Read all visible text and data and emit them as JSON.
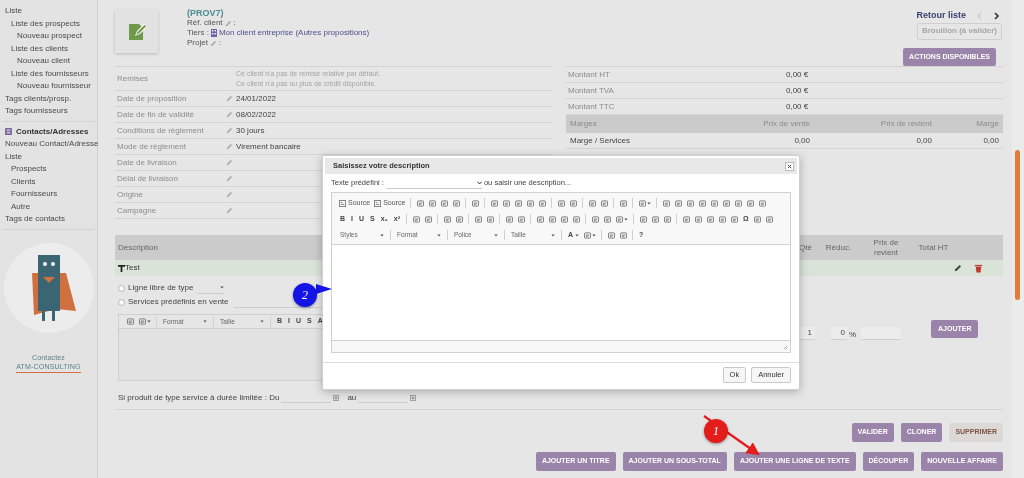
{
  "sidebar": {
    "sections": [
      {
        "items": [
          {
            "label": "Liste",
            "children": [
              {
                "label": "Liste des prospects",
                "children": [
                  {
                    "label": "Nouveau prospect"
                  }
                ]
              },
              {
                "label": "Liste des clients",
                "children": [
                  {
                    "label": "Nouveau client"
                  }
                ]
              },
              {
                "label": "Liste des fournisseurs",
                "children": [
                  {
                    "label": "Nouveau fournisseur"
                  }
                ]
              }
            ]
          },
          {
            "label": "Tags clients/prosp."
          },
          {
            "label": "Tags fournisseurs"
          }
        ]
      },
      {
        "title": "Contacts/Adresses",
        "items": [
          {
            "label": "Nouveau Contact/Adresse"
          },
          {
            "label": "Liste",
            "children": [
              {
                "label": "Prospects"
              },
              {
                "label": "Clients"
              },
              {
                "label": "Fournisseurs"
              },
              {
                "label": "Autre"
              }
            ]
          },
          {
            "label": "Tags de contacts"
          }
        ]
      }
    ],
    "promo": {
      "line_1": "Contactez",
      "line_2": "ATM-CONSULTING"
    }
  },
  "header": {
    "ref": "(PROV7)",
    "fields": [
      {
        "label": "Réf. client",
        "after": ":"
      }
    ],
    "tiers_label": "Tiers :",
    "tiers_link": "Mon client entreprise (Autres propositions)",
    "fields_after": [
      {
        "label": "Projet",
        "after": ":"
      }
    ]
  },
  "nav": {
    "back": "Retour liste",
    "pager": [
      {
        "kind": "prev",
        "disabled": true
      },
      {
        "kind": "next",
        "disabled": false
      }
    ],
    "status": "Brouillon (à valider)",
    "actions_button": "ACTIONS DISPONIBLES"
  },
  "details": [
    {
      "kind": "note",
      "label": "Remises",
      "lines": [
        "Ce client n'a pas de remise relative par défaut.",
        "Ce client n'a pas ou plus de crédit disponible."
      ]
    },
    {
      "kind": "field",
      "label": "Date de proposition",
      "value": "24/01/2022"
    },
    {
      "kind": "field",
      "label": "Date de fin de validité",
      "value": "08/02/2022"
    },
    {
      "kind": "field",
      "label": "Conditions de règlement",
      "value": "30 jours"
    },
    {
      "kind": "field",
      "label": "Mode de règlement",
      "value": "Virement bancaire"
    },
    {
      "kind": "field",
      "label": "Date de livraison"
    },
    {
      "kind": "field",
      "label": "Délai de livraison"
    },
    {
      "kind": "field",
      "label": "Origine"
    },
    {
      "kind": "field",
      "label": "Campagne"
    }
  ],
  "totals": [
    {
      "label": "Montant HT",
      "value": "0,00 €"
    },
    {
      "label": "Montant TVA",
      "value": "0,00 €"
    },
    {
      "label": "Montant TTC",
      "value": "0,00 €"
    }
  ],
  "margins": {
    "columns": [
      "Marges",
      "Prix de vente",
      "Prix de revient",
      "Marge"
    ],
    "rows": [
      [
        "Marge / Services",
        "0,00",
        "0,00",
        "0,00"
      ]
    ]
  },
  "lines": {
    "columns": [
      "Description",
      "Qté",
      "Réduc.",
      "Prix de revient",
      "Total HT"
    ],
    "rows": [
      {
        "title": "Test"
      }
    ],
    "form": {
      "radios": [
        {
          "label": "Ligne libre de type",
          "selected": false
        },
        {
          "label": "Services prédéfinis en vente",
          "selected": false
        }
      ],
      "toolbar": [
        [
          {
            "kind": "icon"
          },
          {
            "kind": "icon",
            "caret": true
          }
        ],
        [
          {
            "kind": "combo",
            "label": "Format"
          }
        ],
        [
          {
            "kind": "combo",
            "label": "Taille"
          }
        ],
        [
          {
            "kind": "glyph",
            "label": "B"
          },
          {
            "kind": "glyph",
            "label": "I"
          },
          {
            "kind": "glyph",
            "label": "U"
          },
          {
            "kind": "glyph",
            "label": "S"
          },
          {
            "kind": "glyph",
            "label": "A"
          }
        ]
      ],
      "qty": "1",
      "discount": "0",
      "percent": "%",
      "add_button": "AJOUTER",
      "duration_label": "Si produit de type service à durée limitée : Du",
      "duration_to": "au"
    }
  },
  "buttons": [
    [
      {
        "label": "VALIDER",
        "kind": "primary"
      },
      {
        "label": "CLONER",
        "kind": "primary"
      },
      {
        "label": "SUPPRIMER",
        "kind": "danger"
      }
    ],
    [
      {
        "label": "AJOUTER UN TITRE",
        "kind": "primary"
      },
      {
        "label": "AJOUTER UN SOUS-TOTAL",
        "kind": "primary"
      },
      {
        "label": "AJOUTER UNE LIGNE DE TEXTE",
        "kind": "primary"
      },
      {
        "label": "DÉCOUPER",
        "kind": "primary"
      },
      {
        "label": "NOUVELLE AFFAIRE",
        "kind": "primary"
      }
    ]
  ],
  "dialog": {
    "title": "Saisissez votre description",
    "predefined_label": "Texte prédéfini :",
    "or_text": "ou saisir une description...",
    "toolbar": [
      [
        [
          {
            "kind": "button",
            "label": "Source"
          },
          {
            "kind": "button",
            "label": "Source"
          }
        ],
        [
          {
            "kind": "icon"
          },
          {
            "kind": "icon"
          },
          {
            "kind": "icon"
          },
          {
            "kind": "icon"
          }
        ],
        [
          {
            "kind": "icon"
          }
        ],
        [
          {
            "kind": "icon"
          },
          {
            "kind": "icon"
          },
          {
            "kind": "icon"
          },
          {
            "kind": "icon"
          },
          {
            "kind": "icon"
          }
        ],
        [
          {
            "kind": "icon"
          },
          {
            "kind": "icon"
          }
        ],
        [
          {
            "kind": "icon"
          },
          {
            "kind": "icon"
          }
        ],
        [
          {
            "kind": "icon"
          }
        ],
        [
          {
            "kind": "icon",
            "caret": true
          }
        ],
        [
          {
            "kind": "icon"
          },
          {
            "kind": "icon"
          },
          {
            "kind": "icon"
          },
          {
            "kind": "icon"
          },
          {
            "kind": "icon"
          },
          {
            "kind": "icon"
          },
          {
            "kind": "icon"
          },
          {
            "kind": "icon"
          },
          {
            "kind": "icon"
          }
        ]
      ],
      [
        [
          {
            "kind": "glyph",
            "label": "B"
          },
          {
            "kind": "glyph",
            "label": "I"
          },
          {
            "kind": "glyph",
            "label": "U"
          },
          {
            "kind": "glyph",
            "label": "S"
          },
          {
            "kind": "glyph",
            "label": "x₂"
          },
          {
            "kind": "glyph",
            "label": "x²"
          }
        ],
        [
          {
            "kind": "icon"
          },
          {
            "kind": "icon"
          }
        ],
        [
          {
            "kind": "icon"
          },
          {
            "kind": "icon"
          }
        ],
        [
          {
            "kind": "icon"
          },
          {
            "kind": "icon"
          }
        ],
        [
          {
            "kind": "icon"
          },
          {
            "kind": "icon"
          }
        ],
        [
          {
            "kind": "icon"
          },
          {
            "kind": "icon"
          },
          {
            "kind": "icon"
          },
          {
            "kind": "icon"
          }
        ],
        [
          {
            "kind": "icon"
          },
          {
            "kind": "icon"
          },
          {
            "kind": "icon",
            "caret": true
          }
        ],
        [
          {
            "kind": "icon"
          },
          {
            "kind": "icon"
          },
          {
            "kind": "icon"
          }
        ],
        [
          {
            "kind": "icon"
          },
          {
            "kind": "icon"
          },
          {
            "kind": "icon"
          },
          {
            "kind": "icon"
          },
          {
            "kind": "icon"
          },
          {
            "kind": "glyph",
            "label": "Ω"
          },
          {
            "kind": "icon"
          },
          {
            "kind": "icon"
          }
        ]
      ],
      [
        [
          {
            "kind": "combo",
            "label": "Styles"
          }
        ],
        [
          {
            "kind": "combo",
            "label": "Format"
          }
        ],
        [
          {
            "kind": "combo",
            "label": "Police"
          }
        ],
        [
          {
            "kind": "combo",
            "label": "Taille"
          }
        ],
        [
          {
            "kind": "glyph",
            "label": "A",
            "caret": true
          },
          {
            "kind": "icon",
            "caret": true
          }
        ],
        [
          {
            "kind": "icon"
          },
          {
            "kind": "icon"
          }
        ],
        [
          {
            "kind": "glyph",
            "label": "?"
          }
        ]
      ]
    ],
    "buttons": [
      "Ok",
      "Annuler"
    ]
  },
  "annotations": [
    {
      "label": "1",
      "color": "#e31c1c"
    },
    {
      "label": "2",
      "color": "#1414e6"
    }
  ]
}
